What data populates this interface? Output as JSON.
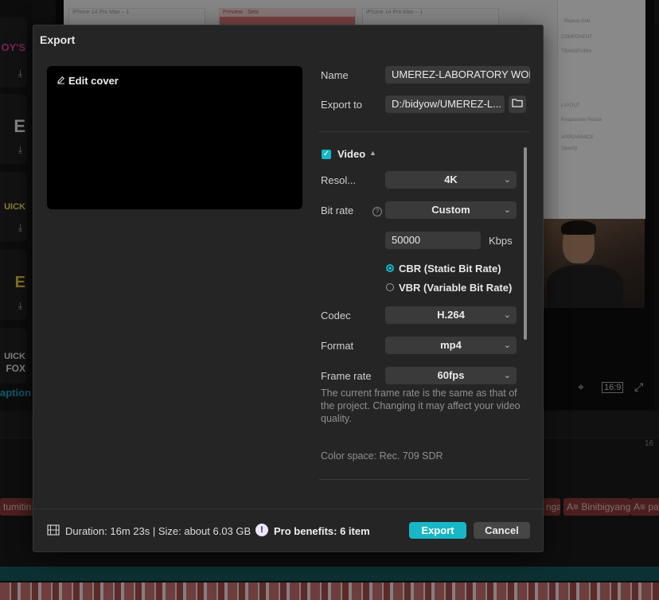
{
  "background": {
    "sticker_labels": [
      "OY'S",
      "E",
      "UICK",
      "E",
      "UICK",
      "FOX"
    ],
    "caption_label": "aption",
    "frame_titles": [
      "iPhone 14 Pro Max – 1",
      "Preview · Sets",
      "iPhone 14 Pro Max – 1"
    ],
    "panel_labels": [
      "Repeat Grid",
      "COMPONENT",
      "TRANSFORM",
      "LAYOUT",
      "Responsive Resize",
      "APPEARANCE",
      "Opacity"
    ],
    "aspect_ratio": "16:9",
    "ruler_mark": "16",
    "clips": [
      "tumitin",
      "nga",
      "A≡ Binibigyang",
      "A≡ pa"
    ]
  },
  "dialog": {
    "title": "Export",
    "edit_cover": "Edit cover",
    "name_label": "Name",
    "name_value": "UMEREZ-LABORATORY WOR",
    "export_to_label": "Export to",
    "export_to_value": "D:/bidyow/UMEREZ-L...",
    "video_section": "Video",
    "resolution_label": "Resol...",
    "resolution_value": "4K",
    "bitrate_label": "Bit rate",
    "bitrate_value": "Custom",
    "bitrate_number": "50000",
    "bitrate_unit": "Kbps",
    "cbr_label": "CBR (Static Bit Rate)",
    "vbr_label": "VBR (Variable Bit Rate)",
    "codec_label": "Codec",
    "codec_value": "H.264",
    "format_label": "Format",
    "format_value": "mp4",
    "framerate_label": "Frame rate",
    "framerate_value": "60fps",
    "framerate_note": "The current frame rate is the same as that of the project. Changing it may affect your video quality.",
    "color_space": "Color space: Rec. 709 SDR",
    "footer_info": "Duration: 16m 23s | Size: about 6.03 GB",
    "pro_benefits": "Pro benefits: 6 item",
    "export_button": "Export",
    "cancel_button": "Cancel"
  },
  "colors": {
    "accent": "#17b7c8",
    "dialog_bg": "#252525",
    "field_bg": "#3a3a3a"
  }
}
